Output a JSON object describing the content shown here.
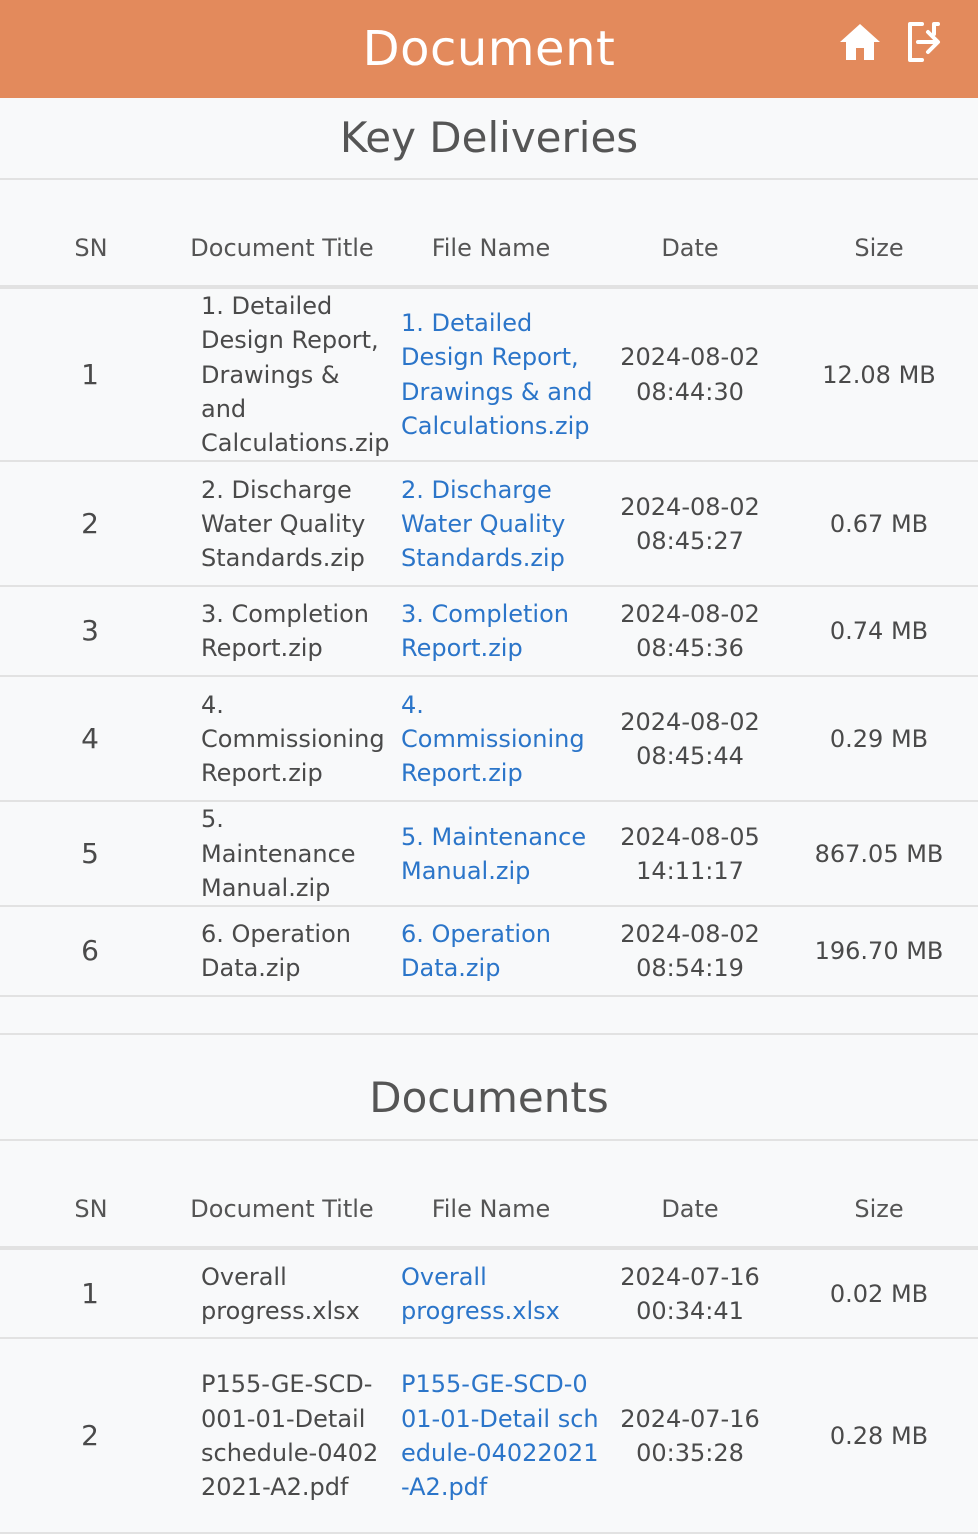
{
  "header": {
    "title": "Document"
  },
  "key_deliveries": {
    "title": "Key Deliveries",
    "columns": {
      "sn": "SN",
      "title": "Document Title",
      "file": "File Name",
      "date": "Date",
      "size": "Size"
    },
    "rows": [
      {
        "sn": "1",
        "title": "1. Detailed Design Report, Drawings & and Calculations.zip",
        "file": "1. Detailed Design Report, Drawings & and Calculations.zip",
        "date": "2024-08-02 08:44:30",
        "size": "12.08 MB"
      },
      {
        "sn": "2",
        "title": "2. Discharge Water Quality Standards.zip",
        "file": "2. Discharge Water Quality Standards.zip",
        "date": "2024-08-02 08:45:27",
        "size": "0.67 MB"
      },
      {
        "sn": "3",
        "title": "3. Completion Report.zip",
        "file": "3. Completion Report.zip",
        "date": "2024-08-02 08:45:36",
        "size": "0.74 MB"
      },
      {
        "sn": "4",
        "title": "4. Commissioning Report.zip",
        "file": "4. Commissioning Report.zip",
        "date": "2024-08-02 08:45:44",
        "size": "0.29 MB"
      },
      {
        "sn": "5",
        "title": "5. Maintenance Manual.zip",
        "file": "5. Maintenance Manual.zip",
        "date": "2024-08-05 14:11:17",
        "size": "867.05 MB"
      },
      {
        "sn": "6",
        "title": "6. Operation Data.zip",
        "file": "6. Operation Data.zip",
        "date": "2024-08-02 08:54:19",
        "size": "196.70 MB"
      }
    ]
  },
  "documents": {
    "title": "Documents",
    "columns": {
      "sn": "SN",
      "title": "Document Title",
      "file": "File Name",
      "date": "Date",
      "size": "Size"
    },
    "rows": [
      {
        "sn": "1",
        "title": "Overall progress.xlsx",
        "file": "Overall progress.xlsx",
        "date": "2024-07-16 00:34:41",
        "size": "0.02 MB"
      },
      {
        "sn": "2",
        "title": "P155-GE-SCD-001-01-Detail schedule-04022021-A2.pdf",
        "file": "P155-GE-SCD-001-01-Detail schedule-04022021-A2.pdf",
        "date": "2024-07-16 00:35:28",
        "size": "0.28 MB"
      }
    ]
  }
}
